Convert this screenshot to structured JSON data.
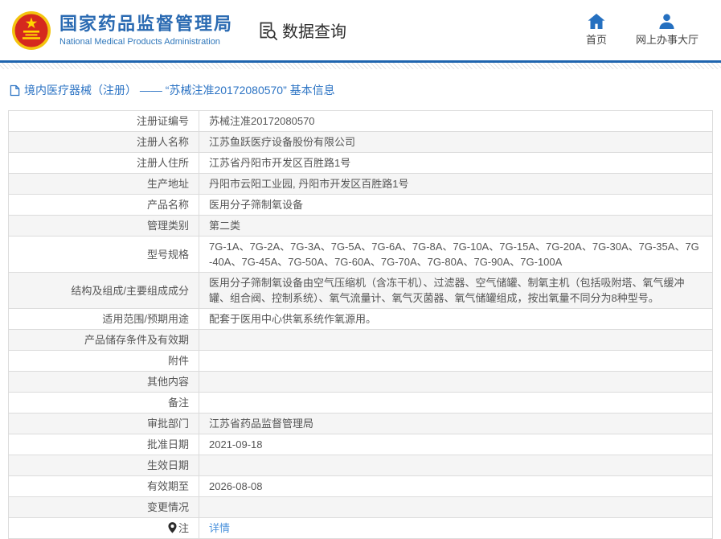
{
  "header": {
    "org_name_cn": "国家药品监督管理局",
    "org_name_en": "National Medical Products Administration",
    "data_query_label": "数据查询",
    "nav": [
      {
        "label": "首页",
        "icon": "home-icon"
      },
      {
        "label": "网上办事大厅",
        "icon": "user-icon"
      }
    ]
  },
  "breadcrumb": {
    "text": "境内医疗器械（注册） —— “苏械注准20172080570” 基本信息",
    "icon": "document-icon"
  },
  "table": {
    "rows": [
      {
        "label": "注册证编号",
        "value": "苏械注准20172080570"
      },
      {
        "label": "注册人名称",
        "value": "江苏鱼跃医疗设备股份有限公司"
      },
      {
        "label": "注册人住所",
        "value": "江苏省丹阳市开发区百胜路1号"
      },
      {
        "label": "生产地址",
        "value": "丹阳市云阳工业园, 丹阳市开发区百胜路1号"
      },
      {
        "label": "产品名称",
        "value": "医用分子筛制氧设备"
      },
      {
        "label": "管理类别",
        "value": "第二类"
      },
      {
        "label": "型号规格",
        "value": "7G-1A、7G-2A、7G-3A、7G-5A、7G-6A、7G-8A、7G-10A、7G-15A、7G-20A、7G-30A、7G-35A、7G-40A、7G-45A、7G-50A、7G-60A、7G-70A、7G-80A、7G-90A、7G-100A"
      },
      {
        "label": "结构及组成/主要组成成分",
        "value": "医用分子筛制氧设备由空气压缩机（含冻干机）、过滤器、空气储罐、制氧主机（包括吸附塔、氧气缓冲罐、组合阀、控制系统）、氧气流量计、氧气灭菌器、氧气储罐组成，按出氧量不同分为8种型号。"
      },
      {
        "label": "适用范围/预期用途",
        "value": "配套于医用中心供氧系统作氧源用。"
      },
      {
        "label": "产品储存条件及有效期",
        "value": ""
      },
      {
        "label": "附件",
        "value": ""
      },
      {
        "label": "其他内容",
        "value": ""
      },
      {
        "label": "备注",
        "value": ""
      },
      {
        "label": "审批部门",
        "value": "江苏省药品监督管理局"
      },
      {
        "label": "批准日期",
        "value": "2021-09-18"
      },
      {
        "label": "生效日期",
        "value": ""
      },
      {
        "label": "有效期至",
        "value": "2026-08-08"
      },
      {
        "label": "变更情况",
        "value": ""
      },
      {
        "label": "注",
        "value": "详情",
        "link": true,
        "label_icon": "pin-icon"
      }
    ]
  },
  "colors": {
    "title_blue": "#2a6ab2",
    "line_blue": "#1e64ae",
    "breadcrumb_blue": "#2d74c4",
    "link_blue": "#4c93dc",
    "row_alt_gray": "#f5f5f5",
    "border_gray": "#dcdcdc",
    "emblem_red": "#d5281e",
    "emblem_gold": "#f3c40f",
    "icon_blue": "#2570c0"
  }
}
